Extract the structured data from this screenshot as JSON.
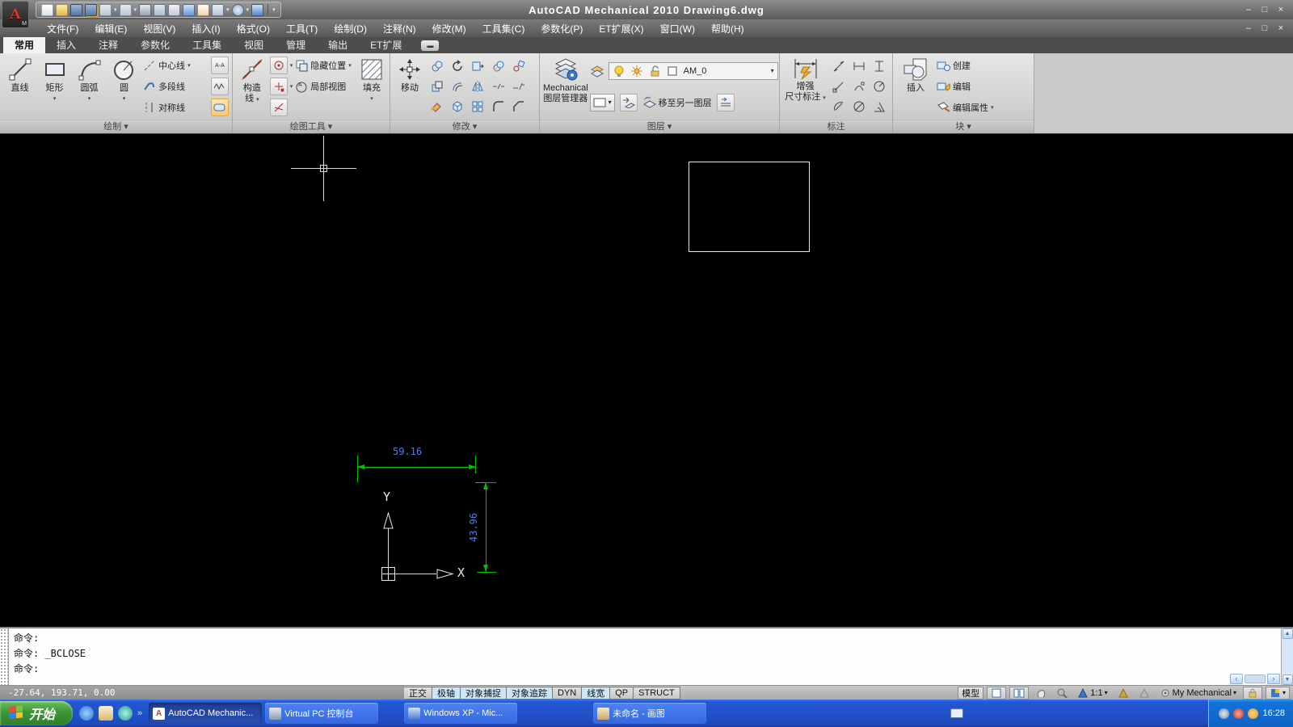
{
  "window": {
    "title": "AutoCAD Mechanical 2010  Drawing6.dwg",
    "controls": {
      "min": "–",
      "max": "□",
      "close": "×"
    }
  },
  "qat": {
    "icons": [
      "new-icon",
      "open-icon",
      "save-icon",
      "save-as-icon",
      "undo-icon",
      "redo-icon",
      "print-icon",
      "properties-icon",
      "calculator-icon",
      "window-icon",
      "page-check-icon",
      "transfer-icon",
      "zoom-globe-icon",
      "display-icon",
      "overflow-icon"
    ]
  },
  "menubar": {
    "items": [
      "文件(F)",
      "编辑(E)",
      "视图(V)",
      "插入(I)",
      "格式(O)",
      "工具(T)",
      "绘制(D)",
      "注释(N)",
      "修改(M)",
      "工具集(C)",
      "参数化(P)",
      "ET扩展(X)",
      "窗口(W)",
      "帮助(H)"
    ]
  },
  "ribbon": {
    "tabs": [
      "常用",
      "插入",
      "注释",
      "参数化",
      "工具集",
      "视图",
      "管理",
      "输出",
      "ET扩展"
    ],
    "active_tab": "常用",
    "panels": {
      "draw": {
        "title": "绘制 ▾",
        "line": "直线",
        "rect": "矩形",
        "arc": "圆弧",
        "circle": "圆",
        "centerline": "中心线",
        "polyline": "多段线",
        "symline": "对称线"
      },
      "draw_tools": {
        "title": "绘图工具 ▾",
        "construction1": "构造",
        "construction2": "线",
        "hide_pos": "隐藏位置",
        "detail_view": "局部视图",
        "hatch": "填充"
      },
      "modify": {
        "title": "修改 ▾",
        "move": "移动"
      },
      "layers": {
        "title": "图层 ▾",
        "manager1": "Mechanical",
        "manager2": "图层管理器",
        "layer_name": "AM_0",
        "move_layer": "移至另一图层"
      },
      "annotate": {
        "title": "标注",
        "power1": "增强",
        "power2": "尺寸标注"
      },
      "block": {
        "title": "块 ▾",
        "insert": "插入",
        "create": "创建",
        "edit": "编辑",
        "edit_attr": "编辑属性"
      }
    }
  },
  "canvas": {
    "dim_width": "59.16",
    "dim_height": "43.96",
    "axis_x": "X",
    "axis_y": "Y",
    "colors": {
      "background": "#000000",
      "dimension_line": "#00bf00",
      "dimension_text": "#4d7de8",
      "geometry": "#e9e9e9"
    }
  },
  "command": {
    "history1": "命令:",
    "history2": "命令: _BCLOSE",
    "prompt": "命令:"
  },
  "statusbar": {
    "coordinates": "-27.64, 193.71, 0.00",
    "toggles": [
      {
        "label": "正交",
        "active": false
      },
      {
        "label": "极轴",
        "active": true
      },
      {
        "label": "对象捕捉",
        "active": true
      },
      {
        "label": "对象追踪",
        "active": true
      },
      {
        "label": "DYN",
        "active": false
      },
      {
        "label": "线宽",
        "active": true
      },
      {
        "label": "QP",
        "active": false
      },
      {
        "label": "STRUCT",
        "active": false
      }
    ],
    "model_label": "模型",
    "annotation_scale": "1:1",
    "workspace": "My Mechanical",
    "dropdown_glyph": "▾"
  },
  "taskbar": {
    "start_label": "开始",
    "buttons": [
      {
        "label": "AutoCAD Mechanic...",
        "active": true
      },
      {
        "label": "Virtual PC 控制台",
        "active": false
      },
      {
        "label": "Windows XP - Mic...",
        "active": false
      },
      {
        "label": "未命名 - 画图",
        "active": false
      }
    ],
    "clock": "16:28"
  }
}
